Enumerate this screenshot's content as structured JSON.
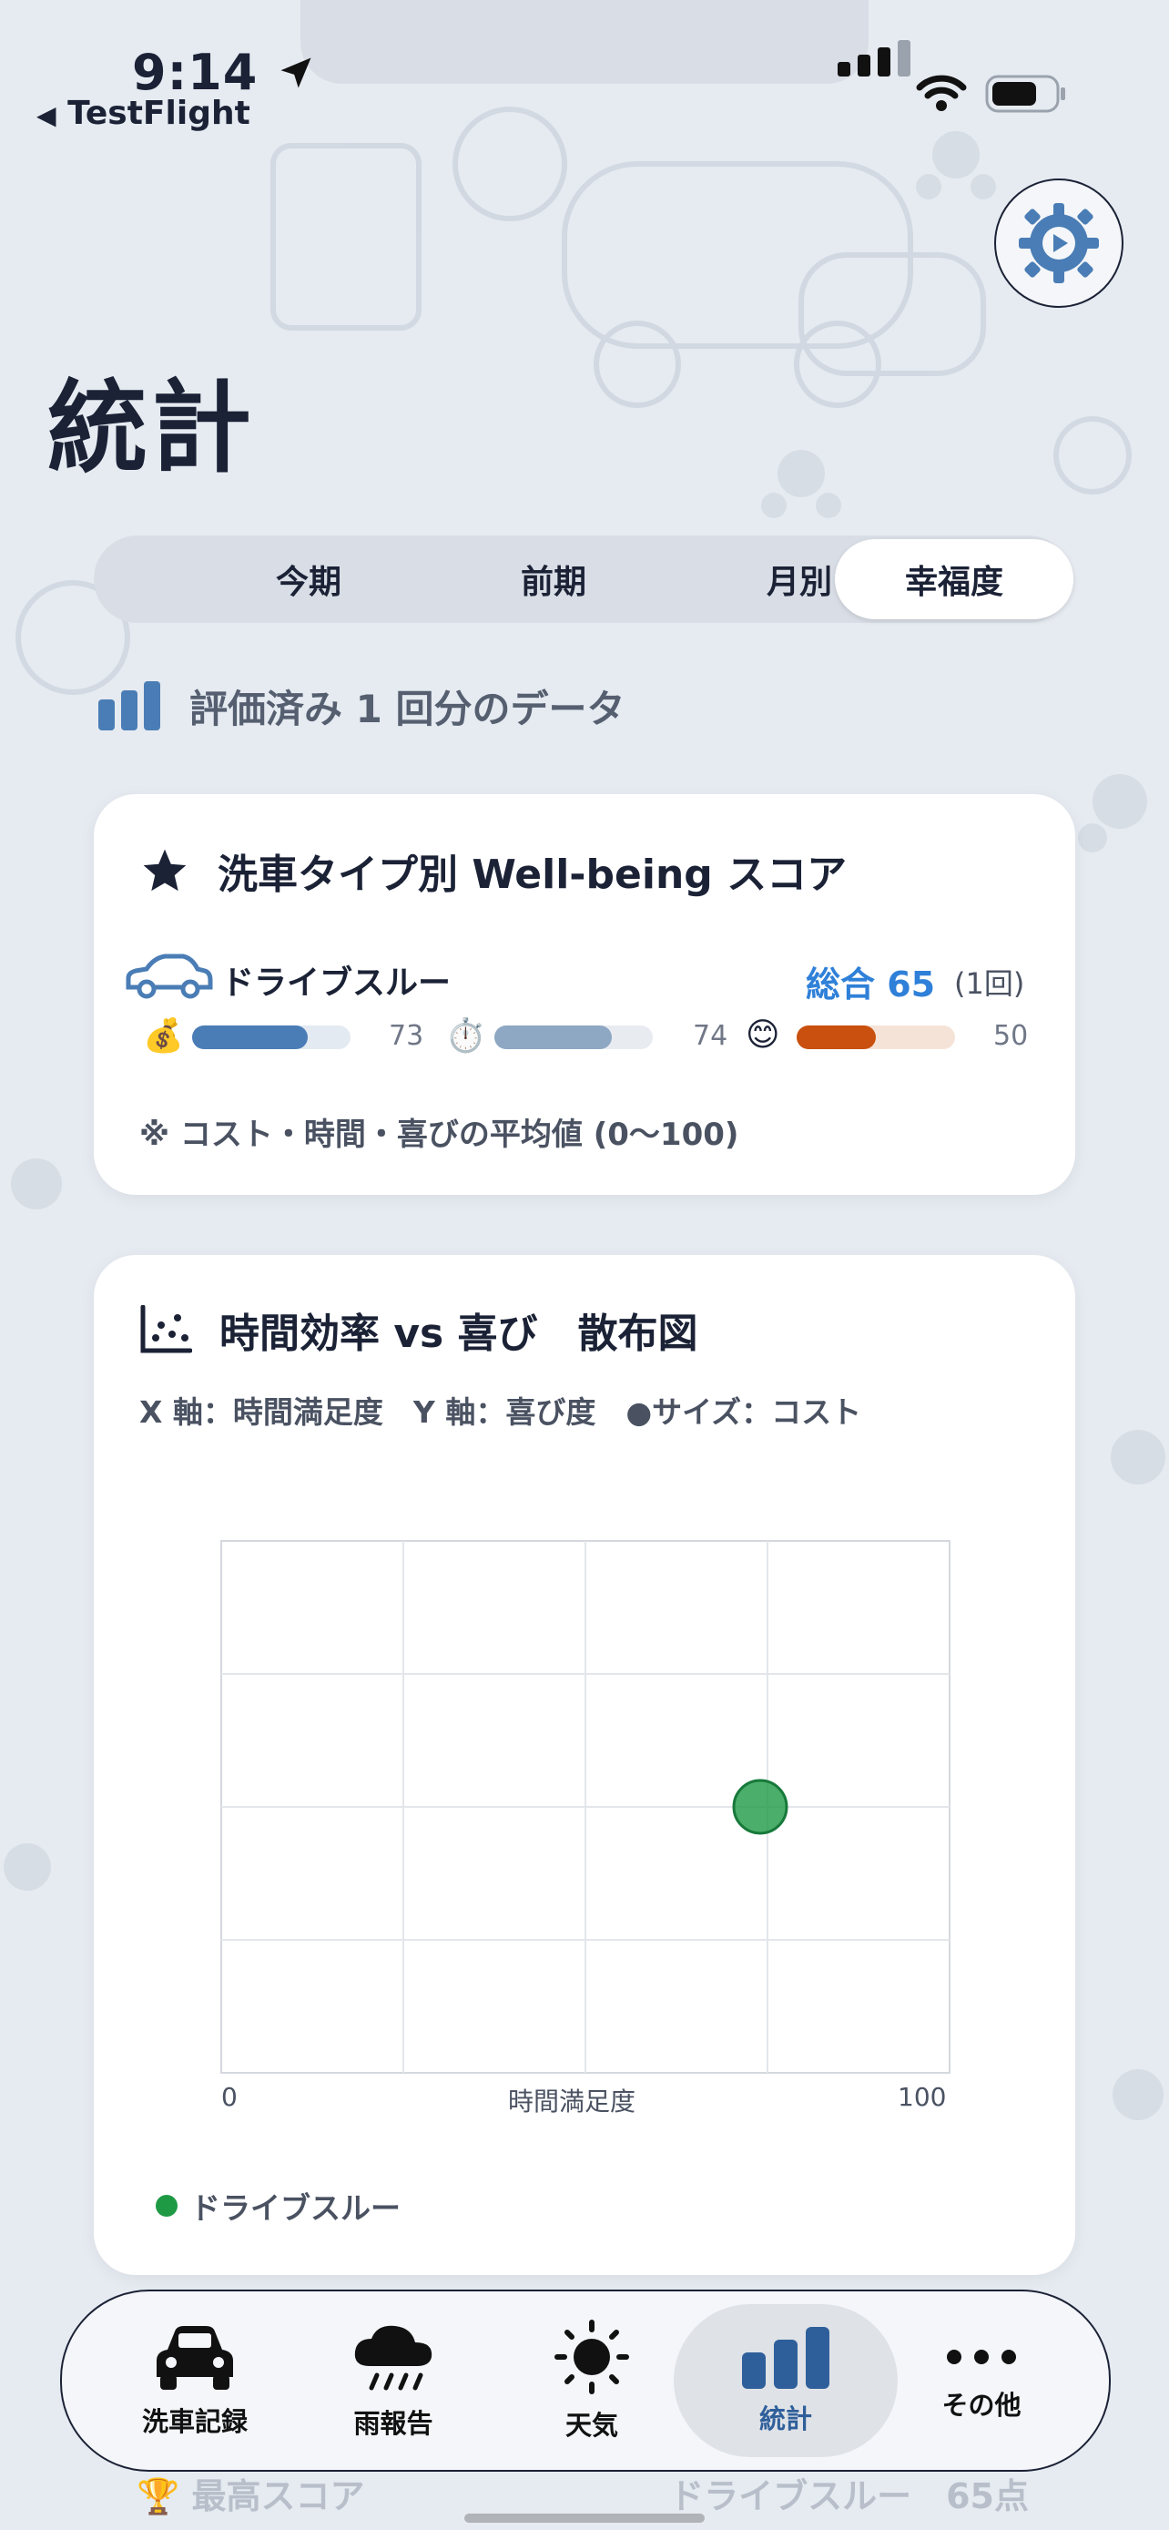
{
  "status_bar": {
    "time": "9:14",
    "back_app": "TestFlight"
  },
  "page": {
    "title": "統計"
  },
  "segments": [
    {
      "label": "今期",
      "active": false
    },
    {
      "label": "前期",
      "active": false
    },
    {
      "label": "月別",
      "active": false
    },
    {
      "label": "幸福度",
      "active": true
    }
  ],
  "info": {
    "text": "評価済み 1 回分のデータ"
  },
  "wellbeing_card": {
    "title": "洗車タイプ別 Well-being スコア",
    "row": {
      "name": "ドライブスルー",
      "total": "総合 65",
      "count": "(1回)",
      "cost": {
        "icon": "💰",
        "value": 73
      },
      "time": {
        "icon": "⏱️",
        "value": 74
      },
      "joy": {
        "icon": "😊",
        "value": 50
      }
    },
    "note": "※ コスト・時間・喜びの平均値 (0〜100)"
  },
  "scatter_card": {
    "title": "時間効率 vs 喜び　散布図",
    "subtitle": "X 軸：時間満足度　Y 軸：喜び度　●サイズ：コスト",
    "legend": "ドライブスルー"
  },
  "chart_data": {
    "type": "scatter",
    "xlabel": "時間満足度",
    "ylabel": "",
    "xlim": [
      0,
      100
    ],
    "ylim": [
      0,
      100
    ],
    "x_tick_labels": [
      "0",
      "100"
    ],
    "grid": true,
    "series": [
      {
        "name": "ドライブスルー",
        "color": "#1e9a45",
        "points": [
          {
            "x": 74,
            "y": 50,
            "size": 73
          }
        ]
      }
    ]
  },
  "tabbar": {
    "items": [
      {
        "label": "洗車記録",
        "icon": "car-icon",
        "active": false
      },
      {
        "label": "雨報告",
        "icon": "rain-cloud-icon",
        "active": false
      },
      {
        "label": "天気",
        "icon": "sun-icon",
        "active": false
      },
      {
        "label": "統計",
        "icon": "bar-chart-icon",
        "active": true
      },
      {
        "label": "その他",
        "icon": "more-icon",
        "active": false
      }
    ]
  },
  "footer": {
    "label": "🏆 最高スコア",
    "value": "ドライブスルー　65点"
  },
  "colors": {
    "accent": "#2f80d8",
    "cost_bar": "#4a7db5",
    "time_bar": "#8ea7c3",
    "joy_bar": "#c9500e"
  }
}
